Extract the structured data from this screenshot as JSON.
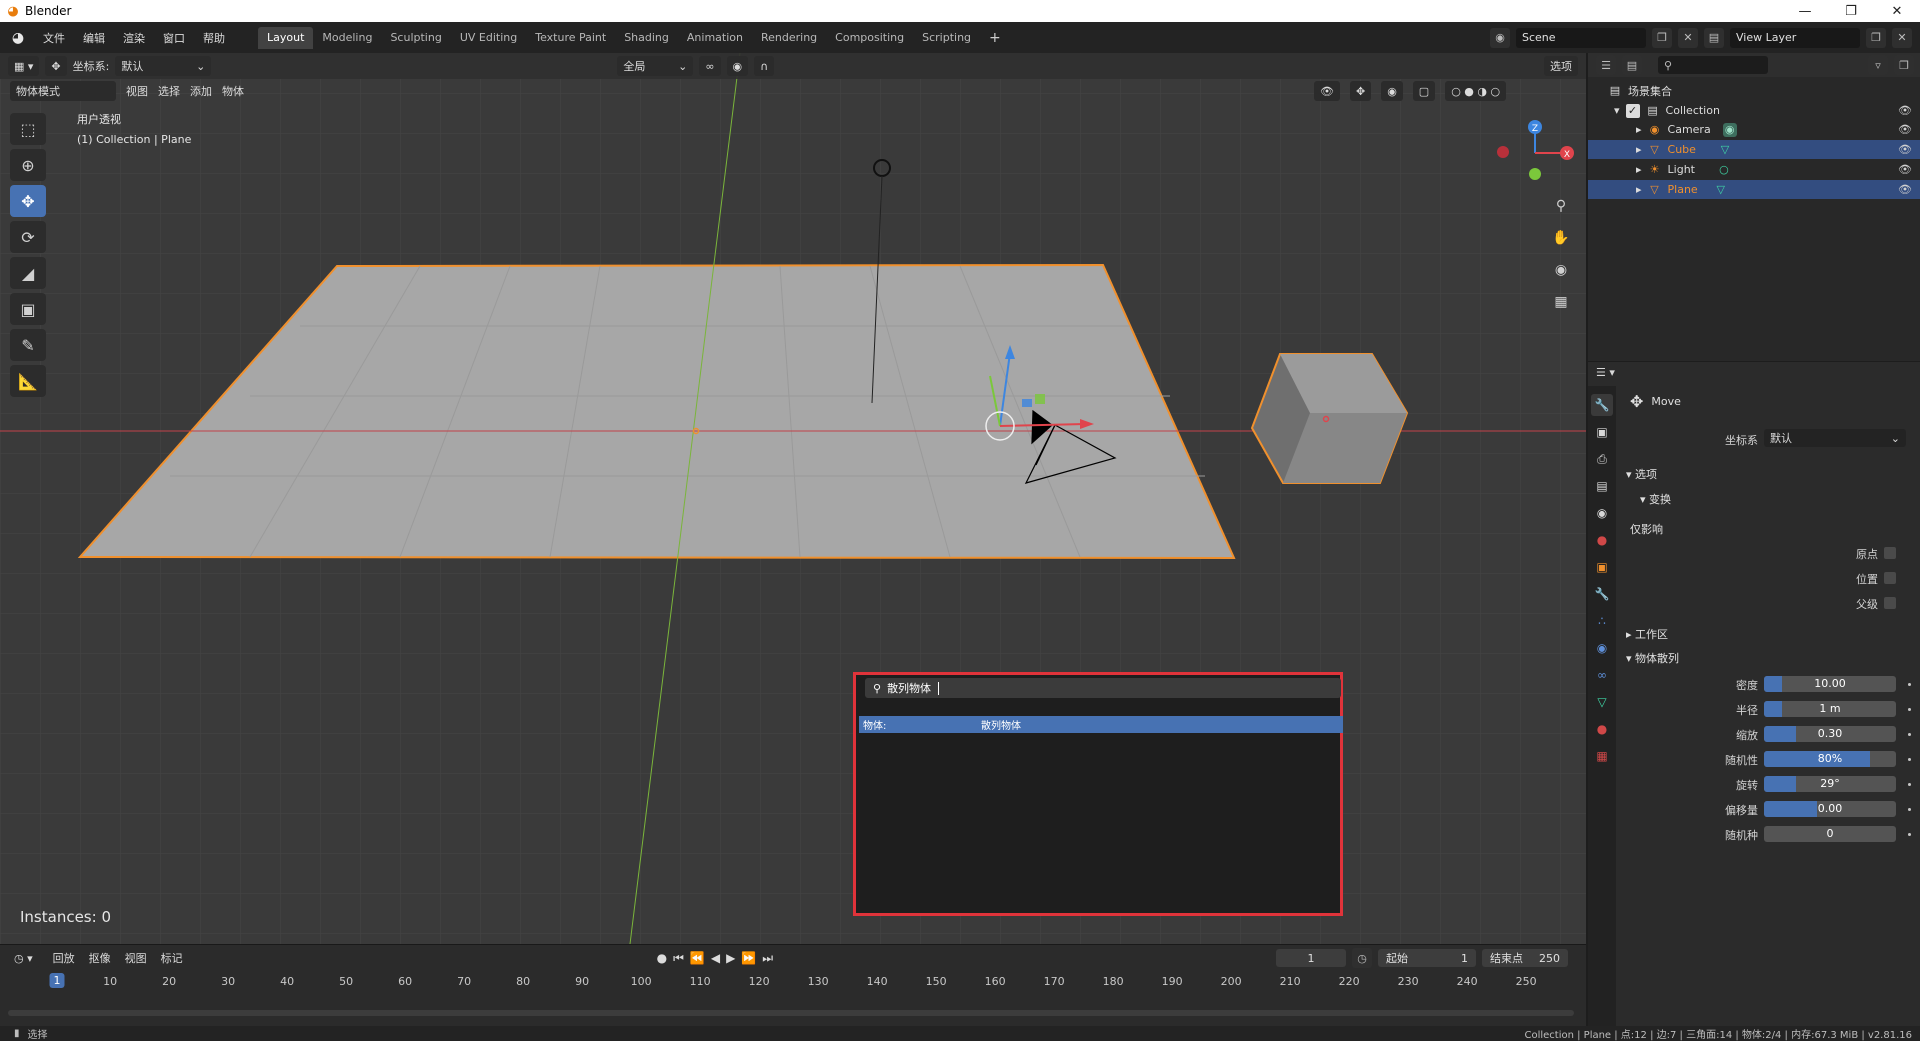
{
  "window": {
    "title": "Blender"
  },
  "topbar": {
    "menu": [
      "文件",
      "编辑",
      "渲染",
      "窗口",
      "帮助"
    ],
    "workspaces": [
      "Layout",
      "Modeling",
      "Sculpting",
      "UV Editing",
      "Texture Paint",
      "Shading",
      "Animation",
      "Rendering",
      "Compositing",
      "Scripting"
    ],
    "active_workspace": "Layout",
    "scene": "Scene",
    "view_layer": "View Layer"
  },
  "viewport": {
    "header": {
      "coord_label": "坐标系:",
      "coord_value": "默认",
      "pivot_value": "全局",
      "options": "选项"
    },
    "header2": {
      "mode": "物体模式",
      "menus": [
        "视图",
        "选择",
        "添加",
        "物体"
      ]
    },
    "info_line1": "用户透视",
    "info_line2": "(1) Collection | Plane",
    "instances": "Instances: 0",
    "gizmo": {
      "z": "Z",
      "x": "X"
    }
  },
  "search_popup": {
    "query": "散列物体",
    "result_category": "物体:",
    "result_name": "散列物体"
  },
  "timeline": {
    "menus": [
      "回放",
      "抠像",
      "视图",
      "标记"
    ],
    "current_frame": "1",
    "start_label": "起始",
    "start_value": "1",
    "end_label": "结束点",
    "end_value": "250",
    "ruler": [
      "1",
      "10",
      "20",
      "30",
      "40",
      "50",
      "60",
      "70",
      "80",
      "90",
      "100",
      "110",
      "120",
      "130",
      "140",
      "150",
      "160",
      "170",
      "180",
      "190",
      "200",
      "210",
      "220",
      "230",
      "240",
      "250"
    ]
  },
  "statusbar": {
    "left": "选择",
    "stats": "Collection | Plane | 点:12 | 边:7 | 三角面:14 | 物体:2/4 | 内存:67.3 MiB | v2.81.16"
  },
  "outliner": {
    "root": "场景集合",
    "collection": "Collection",
    "items": [
      {
        "name": "Camera",
        "selected": false
      },
      {
        "name": "Cube",
        "selected": true
      },
      {
        "name": "Light",
        "selected": false
      },
      {
        "name": "Plane",
        "selected": true
      }
    ]
  },
  "properties": {
    "operator": "Move",
    "coord_label": "坐标系",
    "coord_value": "默认",
    "section_options": "选项",
    "section_transform": "变换",
    "affect_only": "仅影响",
    "check_origin": "原点",
    "check_location": "位置",
    "check_parent": "父级",
    "section_workspace": "工作区",
    "section_scatter": "物体散列",
    "fields": [
      {
        "label": "密度",
        "value": "10.00",
        "fill": 0.14
      },
      {
        "label": "半径",
        "value": "1 m",
        "fill": 0.14
      },
      {
        "label": "缩放",
        "value": "0.30",
        "fill": 0.24
      },
      {
        "label": "随机性",
        "value": "80%",
        "fill": 0.8
      },
      {
        "label": "旋转",
        "value": "29°",
        "fill": 0.24
      },
      {
        "label": "偏移量",
        "value": "0.00",
        "fill": 0.4
      },
      {
        "label": "随机种",
        "value": "0",
        "fill": 0.0
      }
    ]
  },
  "colors": {
    "accent": "#4772b3",
    "selection_outline": "#f0902d",
    "popup_border": "#e0333a"
  }
}
